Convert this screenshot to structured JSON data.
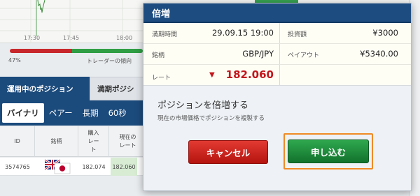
{
  "background": {
    "chart": {
      "time_labels": [
        "17:30",
        "17:45",
        "18:00"
      ],
      "sentiment_down_percent": 47,
      "sentiment_label": "47%",
      "trend_label": "トレーダーの傾向"
    },
    "position_tabs": [
      "運用中のポジション",
      "満期ポジシ"
    ],
    "sub_tabs": [
      "バイナリ",
      "ペアー",
      "長期",
      "60秒"
    ],
    "table": {
      "headers": [
        "ID",
        "銘柄",
        "購入レート",
        "現在のレート"
      ],
      "rows": [
        {
          "id": "3574765",
          "purchase_rate": "182.074",
          "current_rate": "182.060"
        }
      ]
    }
  },
  "modal": {
    "title": "倍増",
    "info": {
      "expiry_label": "満期時間",
      "expiry_value": "29.09.15 19:00",
      "investment_label": "投資額",
      "investment_value": "¥3000",
      "symbol_label": "銘柄",
      "symbol_value": "GBP/JPY",
      "payout_label": "ペイアウト",
      "payout_value": "¥5340.00",
      "rate_label": "レート",
      "rate_arrow": "▼",
      "rate_value": "182.060"
    },
    "heading": "ポジションを倍増する",
    "subtext": "現在の市場価格でポジションを複製する",
    "cancel_label": "キャンセル",
    "apply_label": "申し込む"
  },
  "colors": {
    "header_blue": "#1d4c80",
    "rate_red": "#c4161c",
    "cancel_red": "#c8201a",
    "apply_green": "#1f8c3c",
    "highlight_orange": "#f08a24"
  }
}
